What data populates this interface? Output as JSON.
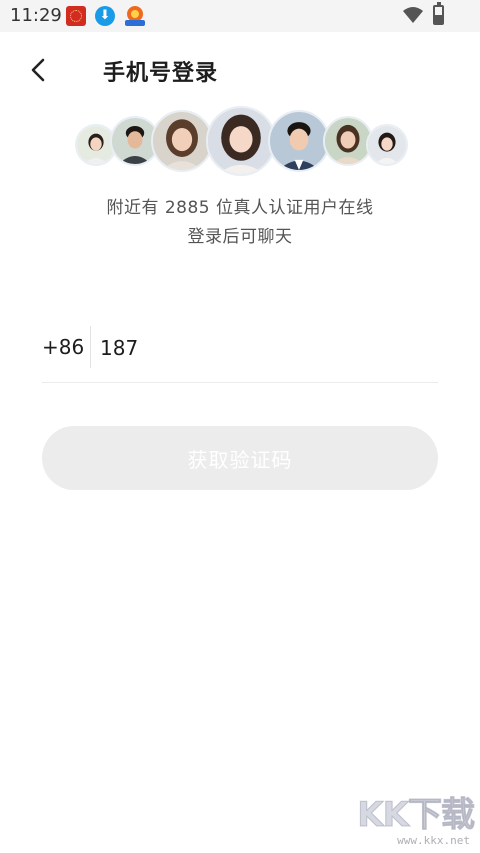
{
  "status_bar": {
    "time": "11:29",
    "notification_icons": [
      "app-notification-icon",
      "download-icon",
      "badge-app-icon"
    ],
    "right_icons": [
      "wifi-icon",
      "battery-charging-icon"
    ]
  },
  "header": {
    "back_icon": "chevron-left-icon",
    "title": "手机号登录"
  },
  "avatars": {
    "count": 7
  },
  "info": {
    "nearby_text": "附近有 2885 位真人认证用户在线",
    "login_hint": "登录后可聊天"
  },
  "phone_form": {
    "country_code": "+86",
    "phone_value": "187"
  },
  "actions": {
    "get_code_label": "获取验证码"
  },
  "watermark": {
    "logo_text": "KK下载",
    "url": "www.kkx.net"
  },
  "colors": {
    "button_disabled_bg": "#ececec",
    "button_text": "#ffffff",
    "title_text": "#1d1d1d",
    "secondary_text": "#555555"
  }
}
